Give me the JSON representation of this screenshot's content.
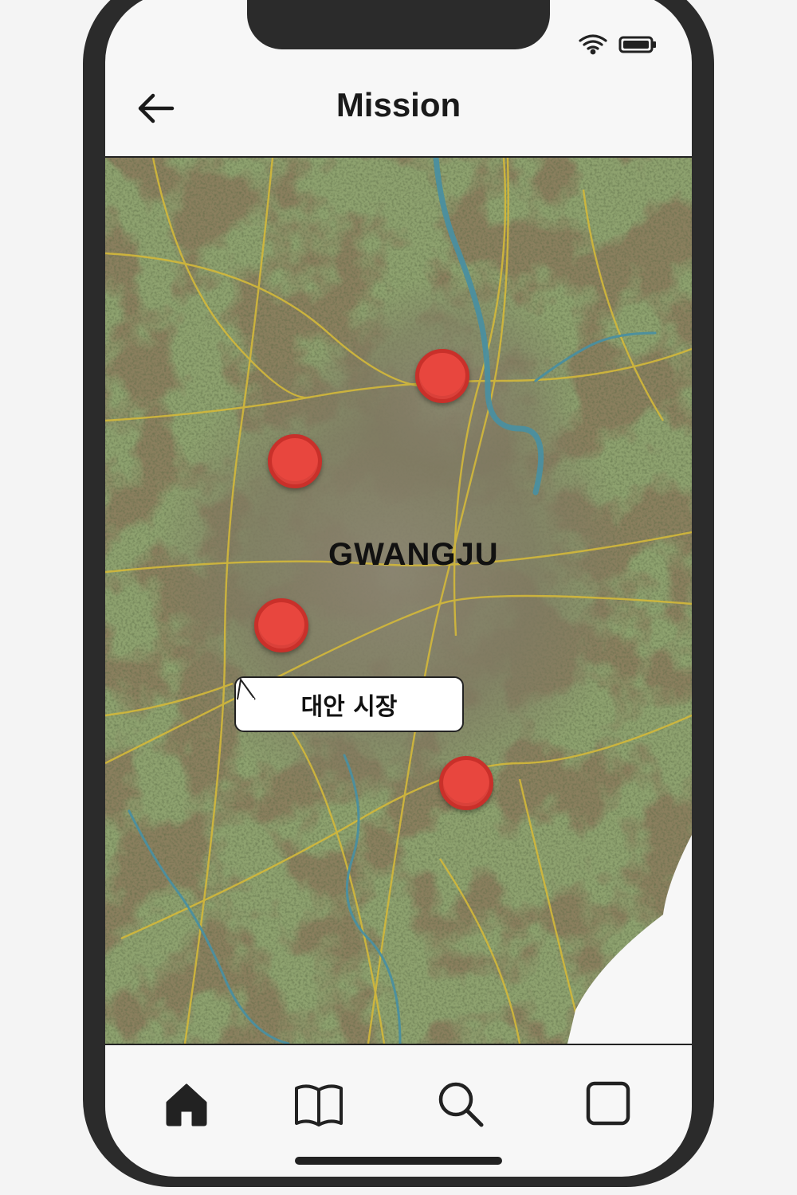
{
  "header": {
    "title": "Mission"
  },
  "map": {
    "city_label": "GWANGJU",
    "markers": [
      {
        "name": "marker-northeast"
      },
      {
        "name": "marker-northwest"
      },
      {
        "name": "marker-daean-market",
        "tooltip": "대안 시장"
      },
      {
        "name": "marker-south"
      }
    ]
  },
  "icons": {
    "back": "arrow-left-icon",
    "wifi": "wifi-icon",
    "battery": "battery-icon",
    "tabs": [
      "home-icon",
      "map-book-icon",
      "search-icon",
      "square-icon"
    ]
  },
  "colors": {
    "marker": "#e8463e",
    "marker_border": "#c9302a",
    "road": "#d4b93a",
    "river": "#4a8fa0"
  }
}
